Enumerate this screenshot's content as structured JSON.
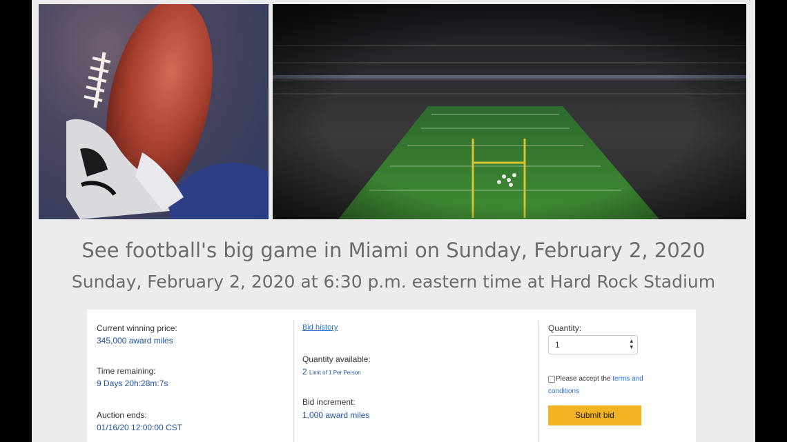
{
  "hero": {
    "left_alt": "football held on kicking tee",
    "right_alt": "stadium field view"
  },
  "headline": {
    "title": "See football's big game in Miami on Sunday, February 2, 2020",
    "subtitle": "Sunday, February 2, 2020 at 6:30 p.m. eastern time at Hard Rock Stadium"
  },
  "auction": {
    "current_price_label": "Current winning price:",
    "current_price_value": "345,000 award miles",
    "time_remaining_label": "Time remaining:",
    "time_remaining_value": "9 Days 20h:28m:7s",
    "auction_ends_label": "Auction ends:",
    "auction_ends_value": "01/16/20 12:00:00 CST",
    "bid_history_link": "Bid history",
    "quantity_available_label": "Quantity available:",
    "quantity_available_value": "2",
    "quantity_limit_note": "Limit of 1 Per Person",
    "bid_increment_label": "Bid increment:",
    "bid_increment_value": "1,000 award miles",
    "quantity_label": "Quantity:",
    "quantity_selected": "1",
    "accept_text": "Please accept the",
    "terms_link_part1": "terms and",
    "terms_link_part2": "conditions",
    "submit_label": "Submit bid"
  },
  "colors": {
    "accent_button": "#f0b323",
    "link": "#2a6fd1",
    "value_text": "#1f4fa3"
  }
}
